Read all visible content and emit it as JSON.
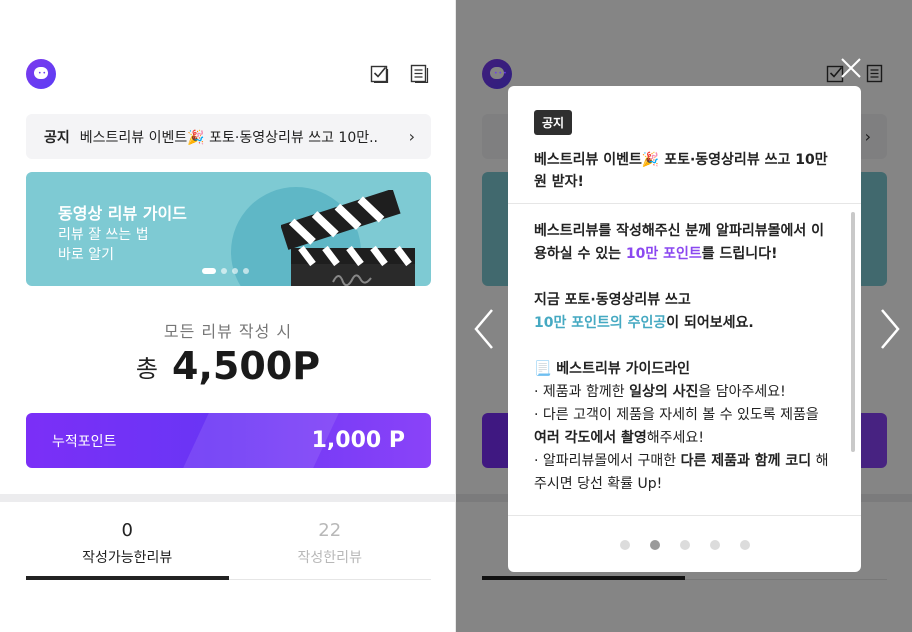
{
  "left": {
    "notice": {
      "tag": "공지",
      "text": "베스트리뷰 이벤트🎉 포토·동영상리뷰 쓰고 10만.."
    },
    "banner": {
      "title": "동영상 리뷰 가이드",
      "sub1": "리뷰 잘 쓰는 법",
      "sub2": "바로 알기"
    },
    "points": {
      "caption": "모든 리뷰 작성 시",
      "prefix": "총",
      "amount": "4,500P"
    },
    "accumulated": {
      "label": "누적포인트",
      "value": "1,000 P"
    },
    "tabs": [
      {
        "count": "0",
        "label": "작성가능한리뷰",
        "active": true
      },
      {
        "count": "22",
        "label": "작성한리뷰",
        "active": false
      }
    ]
  },
  "modal": {
    "tag": "공지",
    "title": "베스트리뷰 이벤트🎉 포토·동영상리뷰 쓰고 10만원 받자!",
    "para1_a": "베스트리뷰를 작성해주신 분께 알파리뷰몰에서 이용하실 수 있는 ",
    "para1_highlight": "10만 포인트",
    "para1_b": "를 드립니다!",
    "para2_line1": "지금 포토·동영상리뷰 쓰고",
    "para2_highlight": "10만 포인트의 주인공",
    "para2_b": "이 되어보세요.",
    "guide_title": "📃 베스트리뷰 가이드라인",
    "guide1_a": "· 제품과 함께한 ",
    "guide1_b": "일상의 사진",
    "guide1_c": "을 담아주세요!",
    "guide2_a": "· 다른 고객이 제품을 자세히 볼 수 있도록 제품을 ",
    "guide2_b": "여러 각도에서 촬영",
    "guide2_c": "해주세요!",
    "guide3_a": "· 알파리뷰몰에서 구매한 ",
    "guide3_b": "다른 제품과 함께 코디",
    "guide3_c": " 해주시면 당선 확률 Up!"
  },
  "colors": {
    "accent": "#7b2ff7",
    "banner": "#7ecad3",
    "highlight_purple": "#8b48f0",
    "highlight_teal": "#45a9c2"
  },
  "icons": [
    "app-logo-icon",
    "review-check-icon",
    "document-list-icon",
    "chevron-right-icon",
    "close-icon",
    "arrow-left-icon",
    "arrow-right-icon"
  ]
}
